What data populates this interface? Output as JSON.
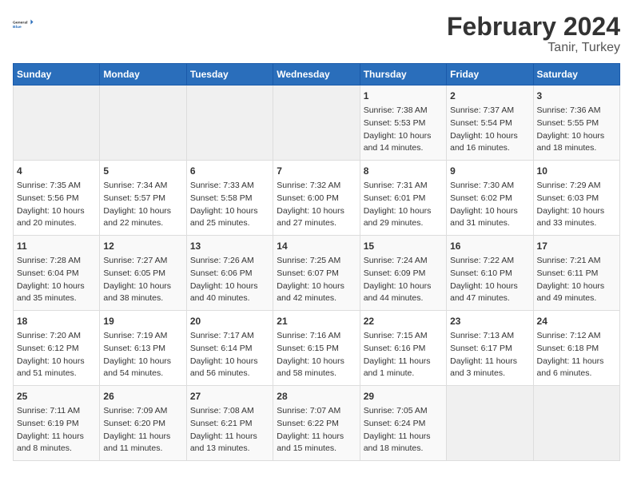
{
  "header": {
    "logo_general": "General",
    "logo_blue": "Blue",
    "title": "February 2024",
    "subtitle": "Tanir, Turkey"
  },
  "days_of_week": [
    "Sunday",
    "Monday",
    "Tuesday",
    "Wednesday",
    "Thursday",
    "Friday",
    "Saturday"
  ],
  "weeks": [
    [
      {
        "day": "",
        "info": ""
      },
      {
        "day": "",
        "info": ""
      },
      {
        "day": "",
        "info": ""
      },
      {
        "day": "",
        "info": ""
      },
      {
        "day": "1",
        "info": "Sunrise: 7:38 AM\nSunset: 5:53 PM\nDaylight: 10 hours\nand 14 minutes."
      },
      {
        "day": "2",
        "info": "Sunrise: 7:37 AM\nSunset: 5:54 PM\nDaylight: 10 hours\nand 16 minutes."
      },
      {
        "day": "3",
        "info": "Sunrise: 7:36 AM\nSunset: 5:55 PM\nDaylight: 10 hours\nand 18 minutes."
      }
    ],
    [
      {
        "day": "4",
        "info": "Sunrise: 7:35 AM\nSunset: 5:56 PM\nDaylight: 10 hours\nand 20 minutes."
      },
      {
        "day": "5",
        "info": "Sunrise: 7:34 AM\nSunset: 5:57 PM\nDaylight: 10 hours\nand 22 minutes."
      },
      {
        "day": "6",
        "info": "Sunrise: 7:33 AM\nSunset: 5:58 PM\nDaylight: 10 hours\nand 25 minutes."
      },
      {
        "day": "7",
        "info": "Sunrise: 7:32 AM\nSunset: 6:00 PM\nDaylight: 10 hours\nand 27 minutes."
      },
      {
        "day": "8",
        "info": "Sunrise: 7:31 AM\nSunset: 6:01 PM\nDaylight: 10 hours\nand 29 minutes."
      },
      {
        "day": "9",
        "info": "Sunrise: 7:30 AM\nSunset: 6:02 PM\nDaylight: 10 hours\nand 31 minutes."
      },
      {
        "day": "10",
        "info": "Sunrise: 7:29 AM\nSunset: 6:03 PM\nDaylight: 10 hours\nand 33 minutes."
      }
    ],
    [
      {
        "day": "11",
        "info": "Sunrise: 7:28 AM\nSunset: 6:04 PM\nDaylight: 10 hours\nand 35 minutes."
      },
      {
        "day": "12",
        "info": "Sunrise: 7:27 AM\nSunset: 6:05 PM\nDaylight: 10 hours\nand 38 minutes."
      },
      {
        "day": "13",
        "info": "Sunrise: 7:26 AM\nSunset: 6:06 PM\nDaylight: 10 hours\nand 40 minutes."
      },
      {
        "day": "14",
        "info": "Sunrise: 7:25 AM\nSunset: 6:07 PM\nDaylight: 10 hours\nand 42 minutes."
      },
      {
        "day": "15",
        "info": "Sunrise: 7:24 AM\nSunset: 6:09 PM\nDaylight: 10 hours\nand 44 minutes."
      },
      {
        "day": "16",
        "info": "Sunrise: 7:22 AM\nSunset: 6:10 PM\nDaylight: 10 hours\nand 47 minutes."
      },
      {
        "day": "17",
        "info": "Sunrise: 7:21 AM\nSunset: 6:11 PM\nDaylight: 10 hours\nand 49 minutes."
      }
    ],
    [
      {
        "day": "18",
        "info": "Sunrise: 7:20 AM\nSunset: 6:12 PM\nDaylight: 10 hours\nand 51 minutes."
      },
      {
        "day": "19",
        "info": "Sunrise: 7:19 AM\nSunset: 6:13 PM\nDaylight: 10 hours\nand 54 minutes."
      },
      {
        "day": "20",
        "info": "Sunrise: 7:17 AM\nSunset: 6:14 PM\nDaylight: 10 hours\nand 56 minutes."
      },
      {
        "day": "21",
        "info": "Sunrise: 7:16 AM\nSunset: 6:15 PM\nDaylight: 10 hours\nand 58 minutes."
      },
      {
        "day": "22",
        "info": "Sunrise: 7:15 AM\nSunset: 6:16 PM\nDaylight: 11 hours\nand 1 minute."
      },
      {
        "day": "23",
        "info": "Sunrise: 7:13 AM\nSunset: 6:17 PM\nDaylight: 11 hours\nand 3 minutes."
      },
      {
        "day": "24",
        "info": "Sunrise: 7:12 AM\nSunset: 6:18 PM\nDaylight: 11 hours\nand 6 minutes."
      }
    ],
    [
      {
        "day": "25",
        "info": "Sunrise: 7:11 AM\nSunset: 6:19 PM\nDaylight: 11 hours\nand 8 minutes."
      },
      {
        "day": "26",
        "info": "Sunrise: 7:09 AM\nSunset: 6:20 PM\nDaylight: 11 hours\nand 11 minutes."
      },
      {
        "day": "27",
        "info": "Sunrise: 7:08 AM\nSunset: 6:21 PM\nDaylight: 11 hours\nand 13 minutes."
      },
      {
        "day": "28",
        "info": "Sunrise: 7:07 AM\nSunset: 6:22 PM\nDaylight: 11 hours\nand 15 minutes."
      },
      {
        "day": "29",
        "info": "Sunrise: 7:05 AM\nSunset: 6:24 PM\nDaylight: 11 hours\nand 18 minutes."
      },
      {
        "day": "",
        "info": ""
      },
      {
        "day": "",
        "info": ""
      }
    ]
  ]
}
